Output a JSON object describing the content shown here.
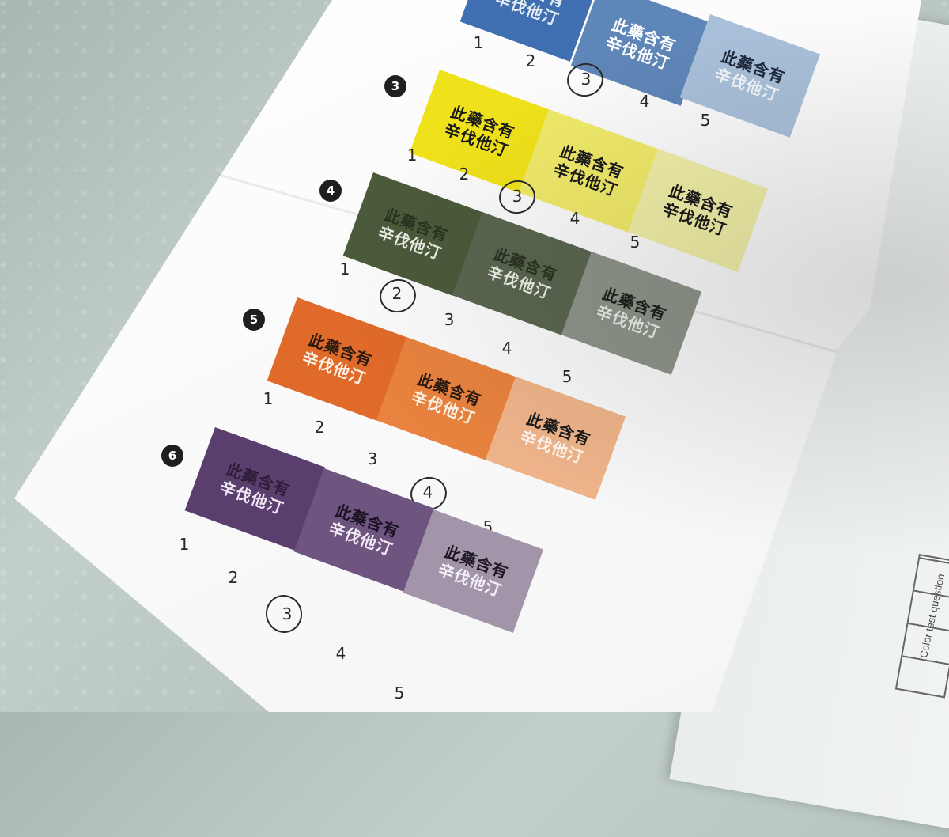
{
  "swatch_text": {
    "line1": "此藥含有",
    "line2": "辛伐他汀"
  },
  "groups": [
    {
      "number": "",
      "scale": [
        "1",
        "2",
        "3",
        "4",
        "5"
      ],
      "circled": "3",
      "colors": [
        "#3f6fb0",
        "#5f86b8",
        "#a9c0da"
      ],
      "text_colors": [
        [
          "#e6ecf5",
          "#e6ecf5"
        ],
        [
          "#ffffff",
          "#ffffff"
        ],
        [
          "#1e2a3a",
          "#f2f5f9"
        ]
      ]
    },
    {
      "number": "3",
      "scale": [
        "1",
        "2",
        "3",
        "4",
        "5"
      ],
      "circled": "3",
      "colors": [
        "#f0e21a",
        "#f0ea6a",
        "#f1efa8"
      ],
      "text_colors": [
        [
          "#1a1a1a",
          "#1a1a1a"
        ],
        [
          "#1a1a1a",
          "#1a1a1a"
        ],
        [
          "#1a1a1a",
          "#1a1a1a"
        ]
      ]
    },
    {
      "number": "4",
      "scale": [
        "1",
        "2",
        "3",
        "4",
        "5"
      ],
      "circled": "2",
      "colors": [
        "#4a5a3a",
        "#5a6650",
        "#8e948a"
      ],
      "text_colors": [
        [
          "#2a3320",
          "#e9ece4"
        ],
        [
          "#2a3320",
          "#e9ece4"
        ],
        [
          "#1e221b",
          "#e9ece4"
        ]
      ]
    },
    {
      "number": "5",
      "scale": [
        "1",
        "2",
        "3",
        "4",
        "5"
      ],
      "circled": "4",
      "colors": [
        "#e06a2a",
        "#e8823e",
        "#efb48a"
      ],
      "text_colors": [
        [
          "#2a1a10",
          "#fff3e8"
        ],
        [
          "#2a1a10",
          "#fff3e8"
        ],
        [
          "#1a1a1a",
          "#fff8f0"
        ]
      ]
    },
    {
      "number": "6",
      "scale": [
        "1",
        "2",
        "3",
        "4",
        "5"
      ],
      "circled": "3",
      "colors": [
        "#5a3e6e",
        "#6e5580",
        "#a295aa"
      ],
      "text_colors": [
        [
          "#2e1e3a",
          "#efe8f4"
        ],
        [
          "#1a1222",
          "#f2ecf6"
        ],
        [
          "#1e1824",
          "#f5f1f8"
        ]
      ]
    }
  ],
  "back_sheet": {
    "label": "Color test question"
  }
}
